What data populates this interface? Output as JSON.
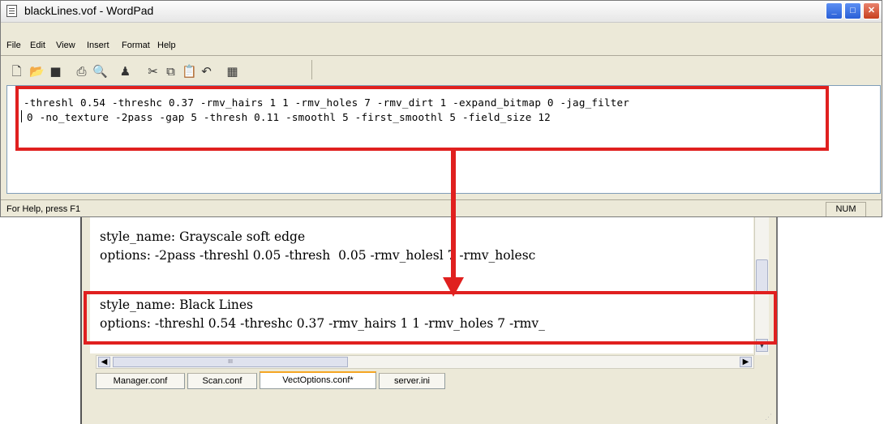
{
  "wordpad": {
    "title": "blackLines.vof - WordPad",
    "menu": [
      "File",
      "Edit",
      "View",
      "Insert",
      "Format",
      "Help"
    ],
    "toolbar_icons": [
      "new-icon",
      "open-icon",
      "save-icon",
      "print-icon",
      "print-preview-icon",
      "find-icon",
      "cut-icon",
      "copy-icon",
      "paste-icon",
      "undo-icon",
      "date-time-icon"
    ],
    "editor_lines": [
      "-threshl 0.54 -threshc 0.37 -rmv_hairs 1 1 -rmv_holes 7 -rmv_dirt 1 -expand_bitmap 0 -jag_filter",
      "0 -no_texture -2pass -gap 5 -thresh 0.11 -smoothl 5 -first_smoothl 5 -field_size 12"
    ],
    "status_text": "For Help, press F1",
    "status_num": "NUM"
  },
  "config_editor": {
    "lines": [
      "style_name: Grayscale soft edge",
      "options: -2pass -threshl 0.05 -thresh  0.05 -rmv_holesl 7 -rmv_holesc",
      "style_name: Black Lines",
      "options: -threshl 0.54 -threshc 0.37 -rmv_hairs 1 1 -rmv_holes 7 -rmv_"
    ],
    "tabs": [
      "Manager.conf",
      "Scan.conf",
      "VectOptions.conf*",
      "server.ini"
    ],
    "active_tab": "VectOptions.conf*"
  },
  "colors": {
    "highlight": "#e0201f",
    "active_tab_accent": "#f5a623"
  }
}
